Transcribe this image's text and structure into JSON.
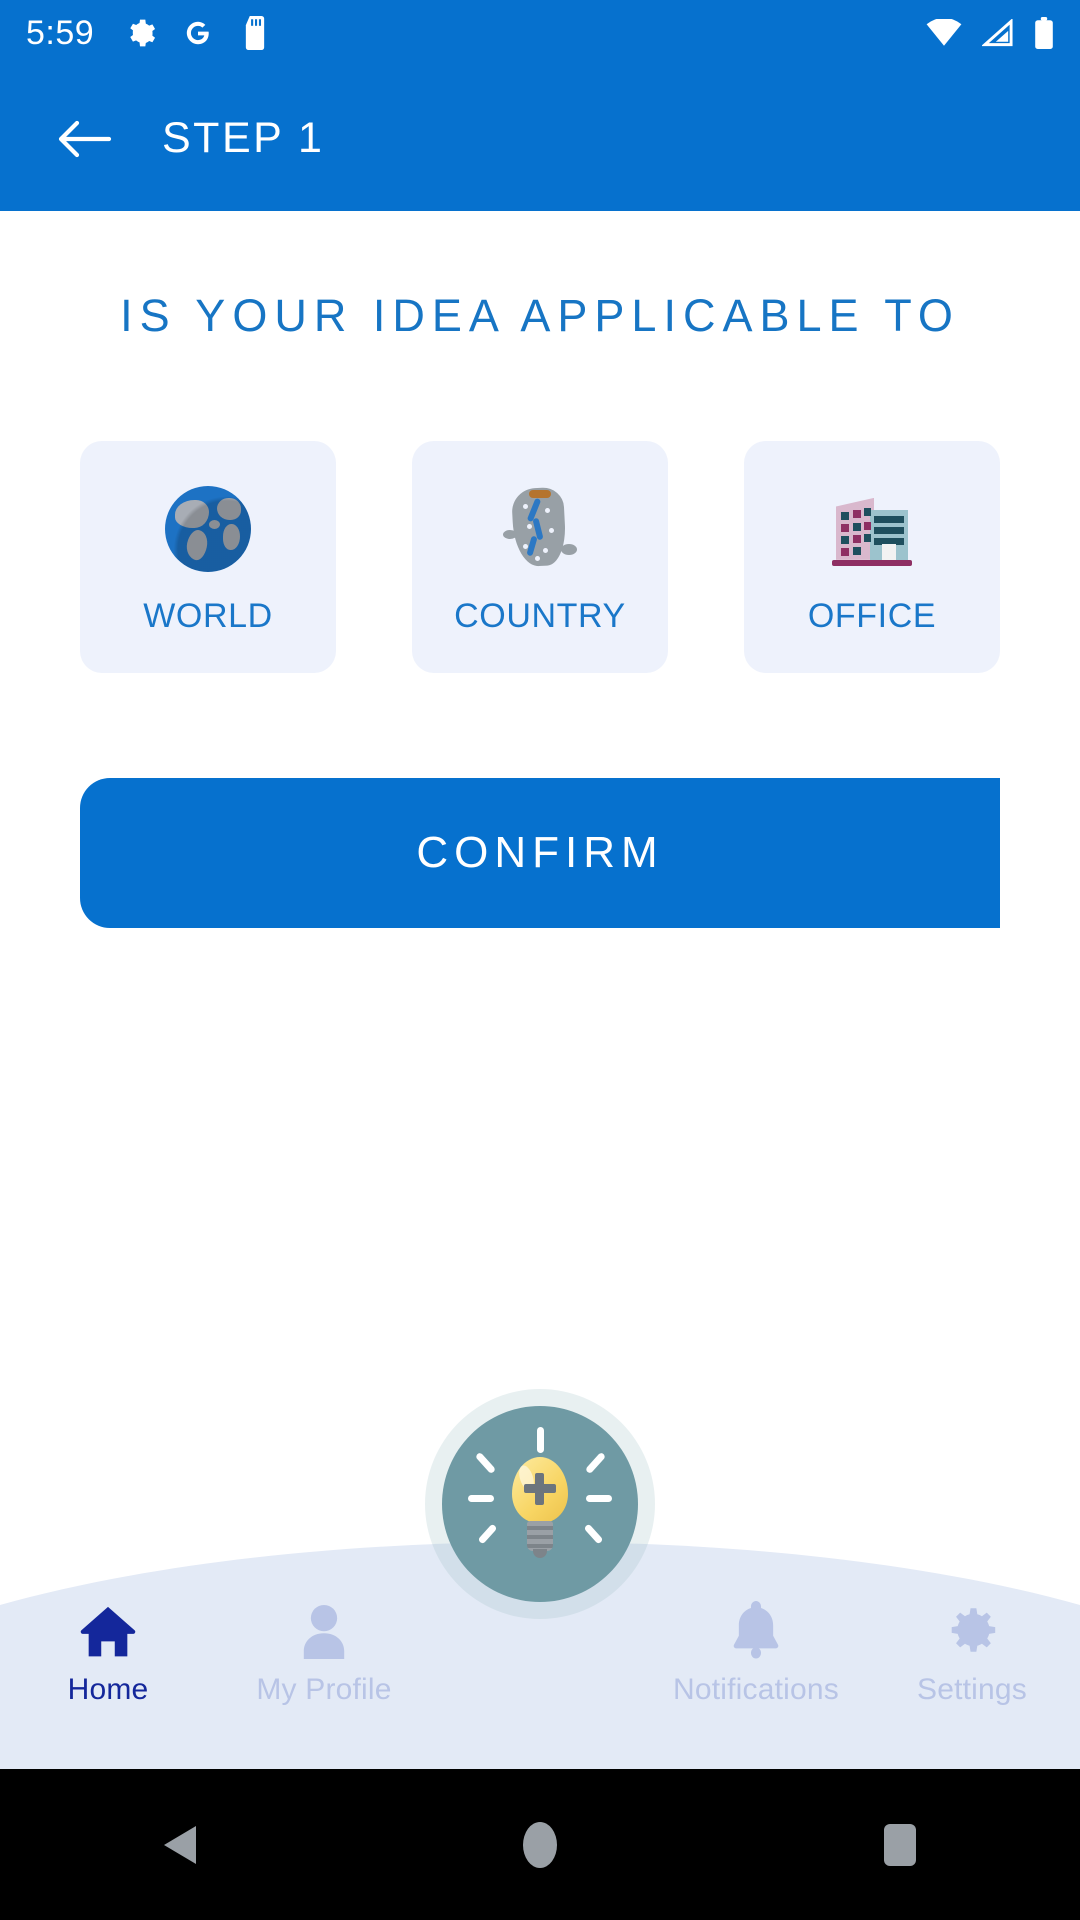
{
  "status_bar": {
    "time": "5:59",
    "left_icons": [
      "gear-icon",
      "google-g-icon",
      "sd-card-icon"
    ],
    "right_icons": [
      "wifi-icon",
      "cellular-signal-icon",
      "battery-icon"
    ],
    "background_color": "#0671ce"
  },
  "app_bar": {
    "title": "STEP 1",
    "back_icon": "arrow-left-icon",
    "background_color": "#0671ce",
    "text_color": "#ffffff"
  },
  "main": {
    "headline": "IS YOUR IDEA APPLICABLE TO",
    "headline_color": "#1775c4",
    "options": [
      {
        "label": "WORLD",
        "icon": "globe-emoji",
        "selected": false
      },
      {
        "label": "COUNTRY",
        "icon": "country-map-emoji",
        "selected": false
      },
      {
        "label": "OFFICE",
        "icon": "office-building-emoji",
        "selected": false
      }
    ],
    "card_background": "#eef2fc",
    "card_label_color": "#1a77c9",
    "confirm_label": "CONFIRM",
    "confirm_color": "#0671ce"
  },
  "bottom_nav": {
    "background_color": "#e3eaf6",
    "active_color": "#14279b",
    "inactive_color": "#b8c4e6",
    "items": [
      {
        "label": "Home",
        "icon": "home-icon",
        "active": true
      },
      {
        "label": "My Profile",
        "icon": "person-icon",
        "active": false
      },
      {
        "label": "Notifications",
        "icon": "bell-icon",
        "active": false
      },
      {
        "label": "Settings",
        "icon": "gear-icon",
        "active": false
      }
    ],
    "fab": {
      "icon": "lightbulb-plus-icon",
      "circle_color": "#6f9aa4",
      "bulb_color": "#f8d563"
    }
  },
  "system_nav": {
    "background_color": "#000000",
    "buttons": [
      "back-triangle-icon",
      "home-circle-icon",
      "recents-square-icon"
    ]
  }
}
